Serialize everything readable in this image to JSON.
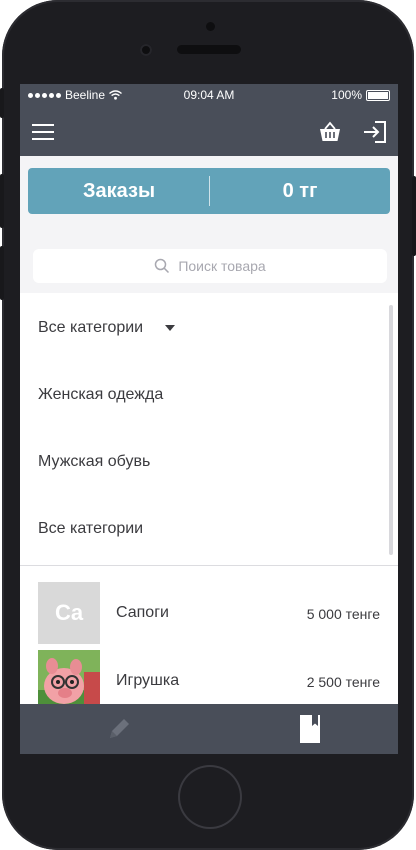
{
  "status_bar": {
    "carrier": "Beeline",
    "time": "09:04 AM",
    "battery": "100%"
  },
  "header": {
    "menu_icon": "hamburger-icon",
    "basket_icon": "basket-icon",
    "logout_icon": "logout-icon"
  },
  "banner": {
    "orders_label": "Заказы",
    "amount": "0 тг"
  },
  "search": {
    "placeholder": "Поиск товара",
    "icon": "search-icon"
  },
  "categories": {
    "selected": "Все категории",
    "items": [
      "Женская одежда",
      "Мужская обувь",
      "Все категории"
    ]
  },
  "products": [
    {
      "thumb_text": "Ca",
      "name": "Сапоги",
      "price": "5 000 тенге"
    },
    {
      "thumb_text": "",
      "name": "Игрушка",
      "price": "2 500 тенге"
    }
  ],
  "tabbar": {
    "left_icon": "pencil-icon",
    "right_icon": "bookmark-icon"
  },
  "colors": {
    "bar": "#494e59",
    "accent": "#62a3b9",
    "background": "#f4f4f6"
  }
}
